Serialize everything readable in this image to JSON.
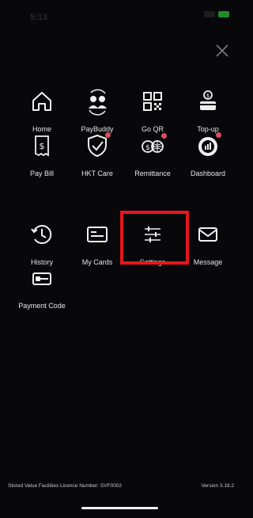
{
  "status": {
    "time": "5:13"
  },
  "menu": {
    "items": [
      {
        "label": "Home",
        "icon": "home-icon"
      },
      {
        "label": "PayBuddy",
        "icon": "paybuddy-icon"
      },
      {
        "label": "Go QR",
        "icon": "qr-code-icon"
      },
      {
        "label": "Top-up",
        "icon": "top-up-icon"
      },
      {
        "label": "Pay Bill",
        "icon": "bill-icon"
      },
      {
        "label": "HKT Care",
        "icon": "shield-check-icon"
      },
      {
        "label": "Remittance",
        "icon": "remittance-icon"
      },
      {
        "label": "Dashboard",
        "icon": "dashboard-icon"
      },
      {
        "label": "History",
        "icon": "history-icon"
      },
      {
        "label": "My Cards",
        "icon": "card-icon"
      },
      {
        "label": "Settings",
        "icon": "sliders-icon"
      },
      {
        "label": "Message",
        "icon": "mail-icon"
      },
      {
        "label": "Payment Code",
        "icon": "payment-code-icon"
      }
    ]
  },
  "footer": {
    "licence": "Stored Value Facilities Licence Number: SVF0002",
    "version": "Version 3.18.2"
  },
  "colors": {
    "background": "#08080b",
    "highlight": "#e6161c",
    "badge": "#e04b5c"
  }
}
